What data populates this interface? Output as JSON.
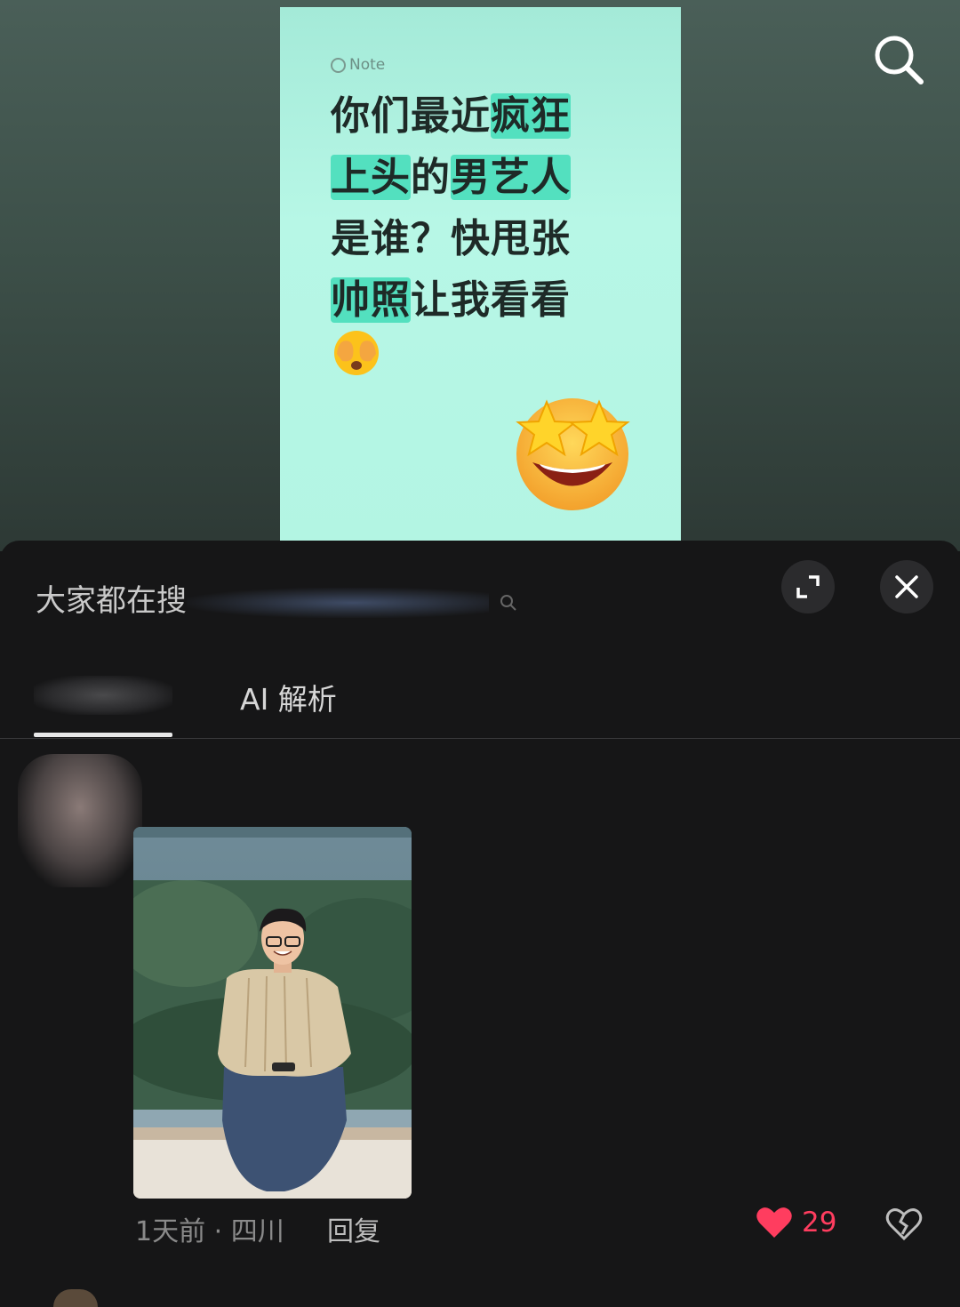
{
  "note": {
    "tag": "Note",
    "lines": [
      [
        {
          "t": "你们最近",
          "hl": false
        },
        {
          "t": "疯狂",
          "hl": true
        }
      ],
      [
        {
          "t": "上头",
          "hl": true
        },
        {
          "t": "的",
          "hl": false
        },
        {
          "t": "男艺人",
          "hl": true
        }
      ],
      [
        {
          "t": "是谁？快甩张",
          "hl": false
        }
      ],
      [
        {
          "t": "帅照",
          "hl": true
        },
        {
          "t": "让我看看",
          "hl": false
        }
      ]
    ]
  },
  "panel": {
    "search_hint_prefix": "大家都在搜",
    "tabs": {
      "ai": "AI 解析"
    }
  },
  "comment": {
    "meta": "1天前 · 四川",
    "reply": "回复",
    "likes": "29"
  },
  "colors": {
    "accent": "#ff3d5f",
    "highlight": "#53e0bf",
    "card": "#b3f5e3"
  },
  "icons": [
    "search-icon",
    "expand-icon",
    "close-icon",
    "heart-icon",
    "broken-heart-icon",
    "peek-emoji",
    "star-eyes-emoji"
  ]
}
